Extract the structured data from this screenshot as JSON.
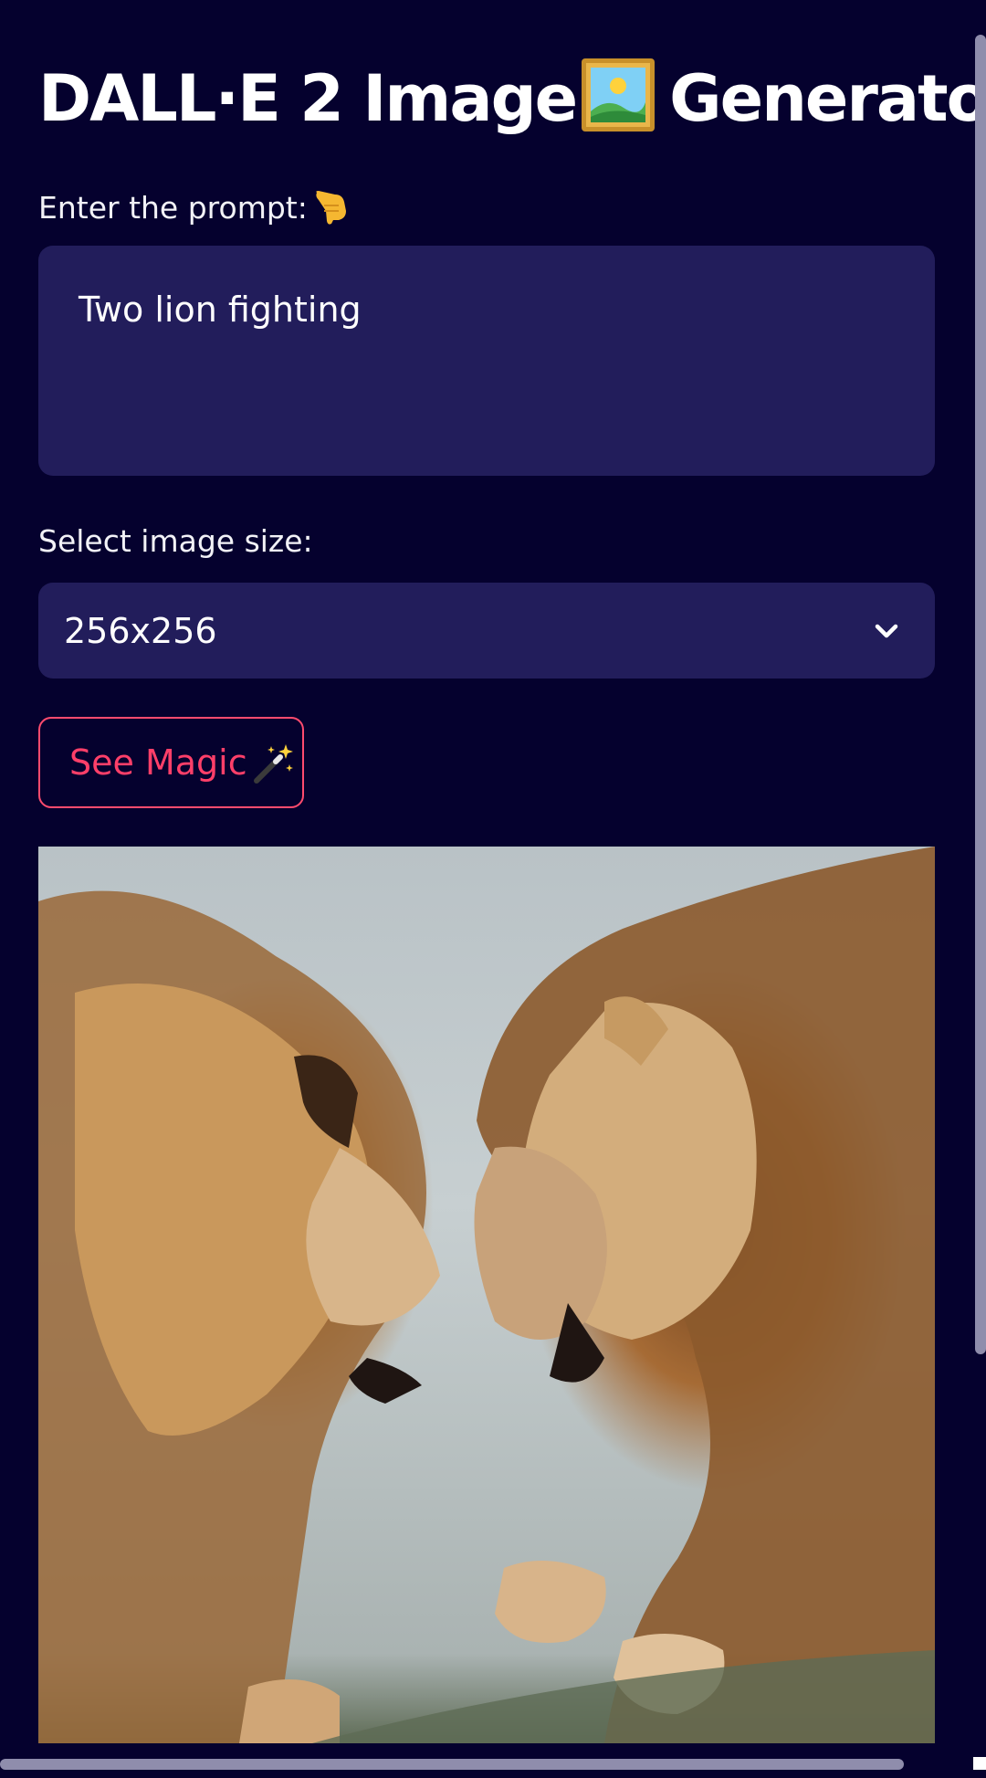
{
  "app": {
    "title": "DALL·E 2 Image",
    "title_suffix": "Generator",
    "title_icon": "framed-picture-icon"
  },
  "prompt": {
    "label": "Enter the prompt:",
    "label_icon": "pointing-down-icon",
    "value": "Two lion fighting"
  },
  "size": {
    "label": "Select image size:",
    "selected": "256x256"
  },
  "button": {
    "label": "See Magic",
    "icon": "magic-wand-icon",
    "color": "#ff4b6e"
  },
  "result": {
    "image": "two-lions-fighting-image"
  },
  "colors": {
    "background": "#05012e",
    "field": "#221d5b",
    "accent": "#ff4b6e"
  }
}
